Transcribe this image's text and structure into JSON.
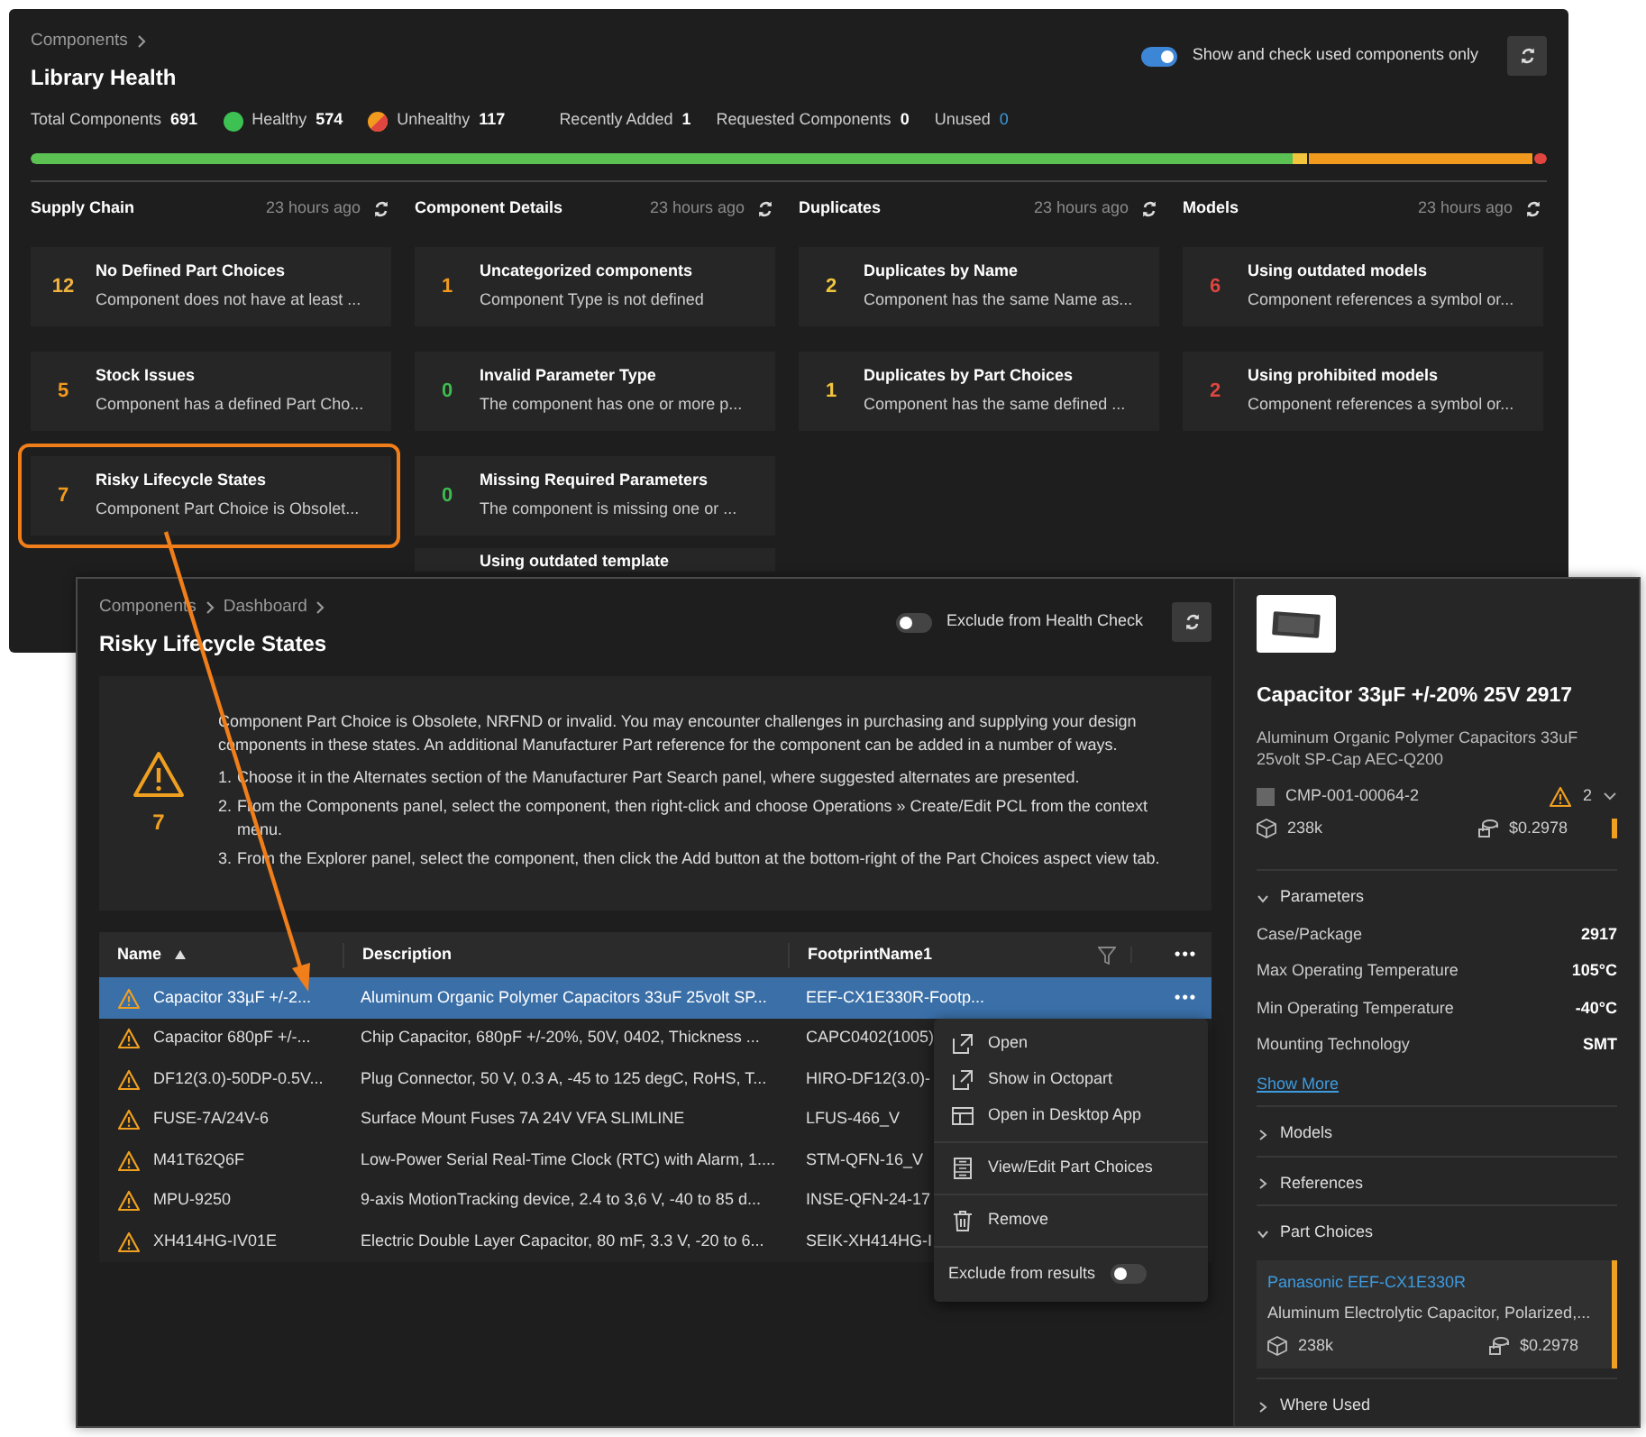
{
  "library_health": {
    "breadcrumb": [
      "Components"
    ],
    "title": "Library Health",
    "used_only_toggle": {
      "label": "Show and check used components only",
      "on": true
    },
    "stats": [
      {
        "label": "Total Components",
        "value": "691",
        "kind": "plain"
      },
      {
        "label": "Healthy",
        "value": "574",
        "kind": "healthy"
      },
      {
        "label": "Unhealthy",
        "value": "117",
        "kind": "unhealthy"
      },
      {
        "label": "Recently Added",
        "value": "1",
        "kind": "plain"
      },
      {
        "label": "Requested Components",
        "value": "0",
        "kind": "plain"
      },
      {
        "label": "Unused",
        "value": "0",
        "kind": "link"
      }
    ],
    "categories": [
      {
        "name": "Supply Chain",
        "updated": "23 hours ago",
        "checks": [
          {
            "count": "12",
            "color": "#f2b33d",
            "title": "No Defined Part Choices",
            "description": "Component does not have at least ...",
            "highlighted": false
          },
          {
            "count": "5",
            "color": "#f29a1e",
            "title": "Stock Issues",
            "description": "Component has a defined Part Cho...",
            "highlighted": false
          },
          {
            "count": "7",
            "color": "#f29a1e",
            "title": "Risky Lifecycle States",
            "description": "Component Part Choice is Obsolet...",
            "highlighted": true
          }
        ]
      },
      {
        "name": "Component Details",
        "updated": "23 hours ago",
        "checks": [
          {
            "count": "1",
            "color": "#f29a1e",
            "title": "Uncategorized components",
            "description": "Component Type is not defined",
            "highlighted": false
          },
          {
            "count": "0",
            "color": "#3dbb4f",
            "title": "Invalid Parameter Type",
            "description": "The component has one or more p...",
            "highlighted": false
          },
          {
            "count": "0",
            "color": "#3dbb4f",
            "title": "Missing Required Parameters",
            "description": "The component is missing one or ...",
            "highlighted": false
          },
          {
            "title": "Using outdated template",
            "highlighted": false
          }
        ]
      },
      {
        "name": "Duplicates",
        "updated": "23 hours ago",
        "checks": [
          {
            "count": "2",
            "color": "#f2c53d",
            "title": "Duplicates by Name",
            "description": "Component has the same Name as...",
            "highlighted": false
          },
          {
            "count": "1",
            "color": "#f2c53d",
            "title": "Duplicates by Part Choices",
            "description": "Component has the same defined ...",
            "highlighted": false
          }
        ]
      },
      {
        "name": "Models",
        "updated": "23 hours ago",
        "checks": [
          {
            "count": "6",
            "color": "#e0463f",
            "title": "Using outdated models",
            "description": "Component references a symbol or...",
            "highlighted": false
          },
          {
            "count": "2",
            "color": "#e0463f",
            "title": "Using prohibited models",
            "description": "Component references a symbol or...",
            "highlighted": false
          }
        ]
      }
    ]
  },
  "detail": {
    "breadcrumb": [
      "Components",
      "Dashboard"
    ],
    "title": "Risky Lifecycle States",
    "exclude_toggle": {
      "label": "Exclude from Health Check",
      "on": false
    },
    "info": {
      "count": "7",
      "text": "Component Part Choice is Obsolete, NRFND or invalid. You may encounter challenges in purchasing and supplying your design components in these states. An additional Manufacturer Part reference for the component can be added in a number of ways.",
      "steps": [
        {
          "marker": "1.",
          "text": "Choose it in the Alternates section of the Manufacturer Part Search panel, where suggested alternates are presented."
        },
        {
          "marker": "2.",
          "text": "From the Components panel, select the component, then right-click and choose Operations » Create/Edit PCL from the context menu."
        },
        {
          "marker": "3.",
          "text": "From the Explorer panel, select the component, then click the Add button at the bottom-right of the Part Choices aspect view tab."
        }
      ]
    },
    "table": {
      "more": "•••",
      "columns": [
        {
          "label": "Name",
          "sorted": true,
          "filter": false
        },
        {
          "label": "Description",
          "sorted": false,
          "filter": false
        },
        {
          "label": "FootprintName1",
          "sorted": false,
          "filter": true
        }
      ],
      "rows": [
        {
          "name": "Capacitor 33µF +/-2...",
          "description": "Aluminum Organic Polymer Capacitors 33uF 25volt SP...",
          "footprint": "EEF-CX1E330R-Footp...",
          "actions": "•••",
          "selected": true
        },
        {
          "name": "Capacitor 680pF +/-...",
          "description": "Chip Capacitor, 680pF +/-20%, 50V, 0402, Thickness ...",
          "footprint": "CAPC0402(1005)",
          "selected": false
        },
        {
          "name": "DF12(3.0)-50DP-0.5V...",
          "description": "Plug Connector, 50 V, 0.3 A, -45 to 125 degC, RoHS, T...",
          "footprint": "HIRO-DF12(3.0)-",
          "selected": false
        },
        {
          "name": "FUSE-7A/24V-6",
          "description": "Surface Mount Fuses 7A 24V VFA SLIMLINE",
          "footprint": "LFUS-466_V",
          "selected": false
        },
        {
          "name": "M41T62Q6F",
          "description": "Low-Power Serial Real-Time Clock (RTC) with Alarm, 1....",
          "footprint": "STM-QFN-16_V",
          "selected": false
        },
        {
          "name": "MPU-9250",
          "description": "9-axis MotionTracking device, 2.4 to 3,6 V, -40 to 85 d...",
          "footprint": "INSE-QFN-24-17",
          "selected": false
        },
        {
          "name": "XH414HG-IV01E",
          "description": "Electric Double Layer Capacitor, 80 mF, 3.3 V, -20 to 6...",
          "footprint": "SEIK-XH414HG-I",
          "selected": false
        }
      ]
    },
    "context_menu": {
      "groups": [
        [
          "Open",
          "Show in Octopart",
          "Open in Desktop App"
        ],
        [
          "View/Edit Part Choices"
        ],
        [
          "Remove"
        ]
      ],
      "exclude_toggle": {
        "label": "Exclude from results",
        "on": false
      }
    }
  },
  "inspector": {
    "title": "Capacitor 33µF +/-20% 25V 2917",
    "description": "Aluminum Organic Polymer Capacitors 33uF 25volt SP-Cap AEC-Q200",
    "id": "CMP-001-00064-2",
    "warnings": "2",
    "stock": "238k",
    "price": "$0.2978",
    "sections": [
      {
        "label": "Parameters",
        "expanded": true,
        "parameters": [
          {
            "name": "Case/Package",
            "value": "2917"
          },
          {
            "name": "Max Operating Temperature",
            "value": "105°C"
          },
          {
            "name": "Min Operating Temperature",
            "value": "-40°C"
          },
          {
            "name": "Mounting Technology",
            "value": "SMT"
          }
        ],
        "link": "Show More"
      },
      {
        "label": "Models",
        "expanded": false
      },
      {
        "label": "References",
        "expanded": false
      },
      {
        "label": "Part Choices",
        "expanded": true,
        "part_choices": [
          {
            "name": "Panasonic EEF-CX1E330R",
            "description": "Aluminum Electrolytic Capacitor, Polarized,...",
            "stock": "238k",
            "price": "$0.2978"
          }
        ]
      },
      {
        "label": "Where Used",
        "expanded": false
      }
    ]
  }
}
